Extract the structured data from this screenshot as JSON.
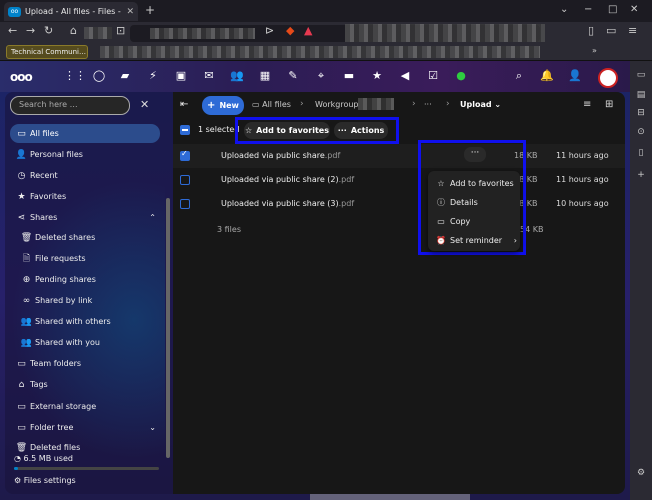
{
  "browser": {
    "tab_title": "Upload - All files - Files - Nextc",
    "tab_close": "✕",
    "new_tab": "+",
    "bookmark": "Technical Communi…",
    "controls": {
      "minimize": "−",
      "maximize": "□",
      "close": "✕"
    }
  },
  "search": {
    "placeholder": "Search here …"
  },
  "breadcrumb": {
    "new_label": "New",
    "all_files": "All files",
    "workgroup": "Workgroup",
    "ellipsis": "···",
    "current": "Upload"
  },
  "selection": {
    "text": "1 selected",
    "add_to_favorites": "Add to favorites",
    "actions": "Actions"
  },
  "sidebar": {
    "items": [
      {
        "icon": "▭",
        "label": "All files"
      },
      {
        "icon": "👤",
        "label": "Personal files"
      },
      {
        "icon": "◷",
        "label": "Recent"
      },
      {
        "icon": "★",
        "label": "Favorites"
      },
      {
        "icon": "⋖",
        "label": "Shares",
        "chev": "⌃"
      },
      {
        "icon": "🗑",
        "label": "Deleted shares"
      },
      {
        "icon": "🗎",
        "label": "File requests"
      },
      {
        "icon": "⊕",
        "label": "Pending shares"
      },
      {
        "icon": "∞",
        "label": "Shared by link"
      },
      {
        "icon": "👥",
        "label": "Shared with others"
      },
      {
        "icon": "👥",
        "label": "Shared with you"
      },
      {
        "icon": "▭",
        "label": "Team folders"
      },
      {
        "icon": "⌂",
        "label": "Tags"
      },
      {
        "icon": "▭",
        "label": "External storage"
      },
      {
        "icon": "▭",
        "label": "Folder tree",
        "chev": "⌄"
      },
      {
        "icon": "🗑",
        "label": "Deleted files"
      }
    ],
    "quota": "6.5 MB used",
    "quota_fraction": 0.03,
    "settings": "Files settings"
  },
  "files": {
    "rows": [
      {
        "name": "Uploaded via public share",
        "ext": ".pdf",
        "size": "18 KB",
        "modified": "11 hours ago",
        "selected": true
      },
      {
        "name": "Uploaded via public share (2)",
        "ext": ".pdf",
        "size": "18 KB",
        "modified": "11 hours ago",
        "selected": false
      },
      {
        "name": "Uploaded via public share (3)",
        "ext": ".pdf",
        "size": "18 KB",
        "modified": "10 hours ago",
        "selected": false
      }
    ],
    "count": "3 files",
    "total_size": "54 KB"
  },
  "context_menu": {
    "items": [
      {
        "icon": "☆",
        "label": "Add to favorites"
      },
      {
        "icon": "ⓘ",
        "label": "Details"
      },
      {
        "icon": "▭",
        "label": "Copy"
      },
      {
        "icon": "⏰",
        "label": "Set reminder",
        "chev": "›"
      }
    ]
  },
  "colors": {
    "accent": "#2e6bd6",
    "highlight_box": "#1010ee",
    "header_gradient_start": "#2a2d6b"
  }
}
